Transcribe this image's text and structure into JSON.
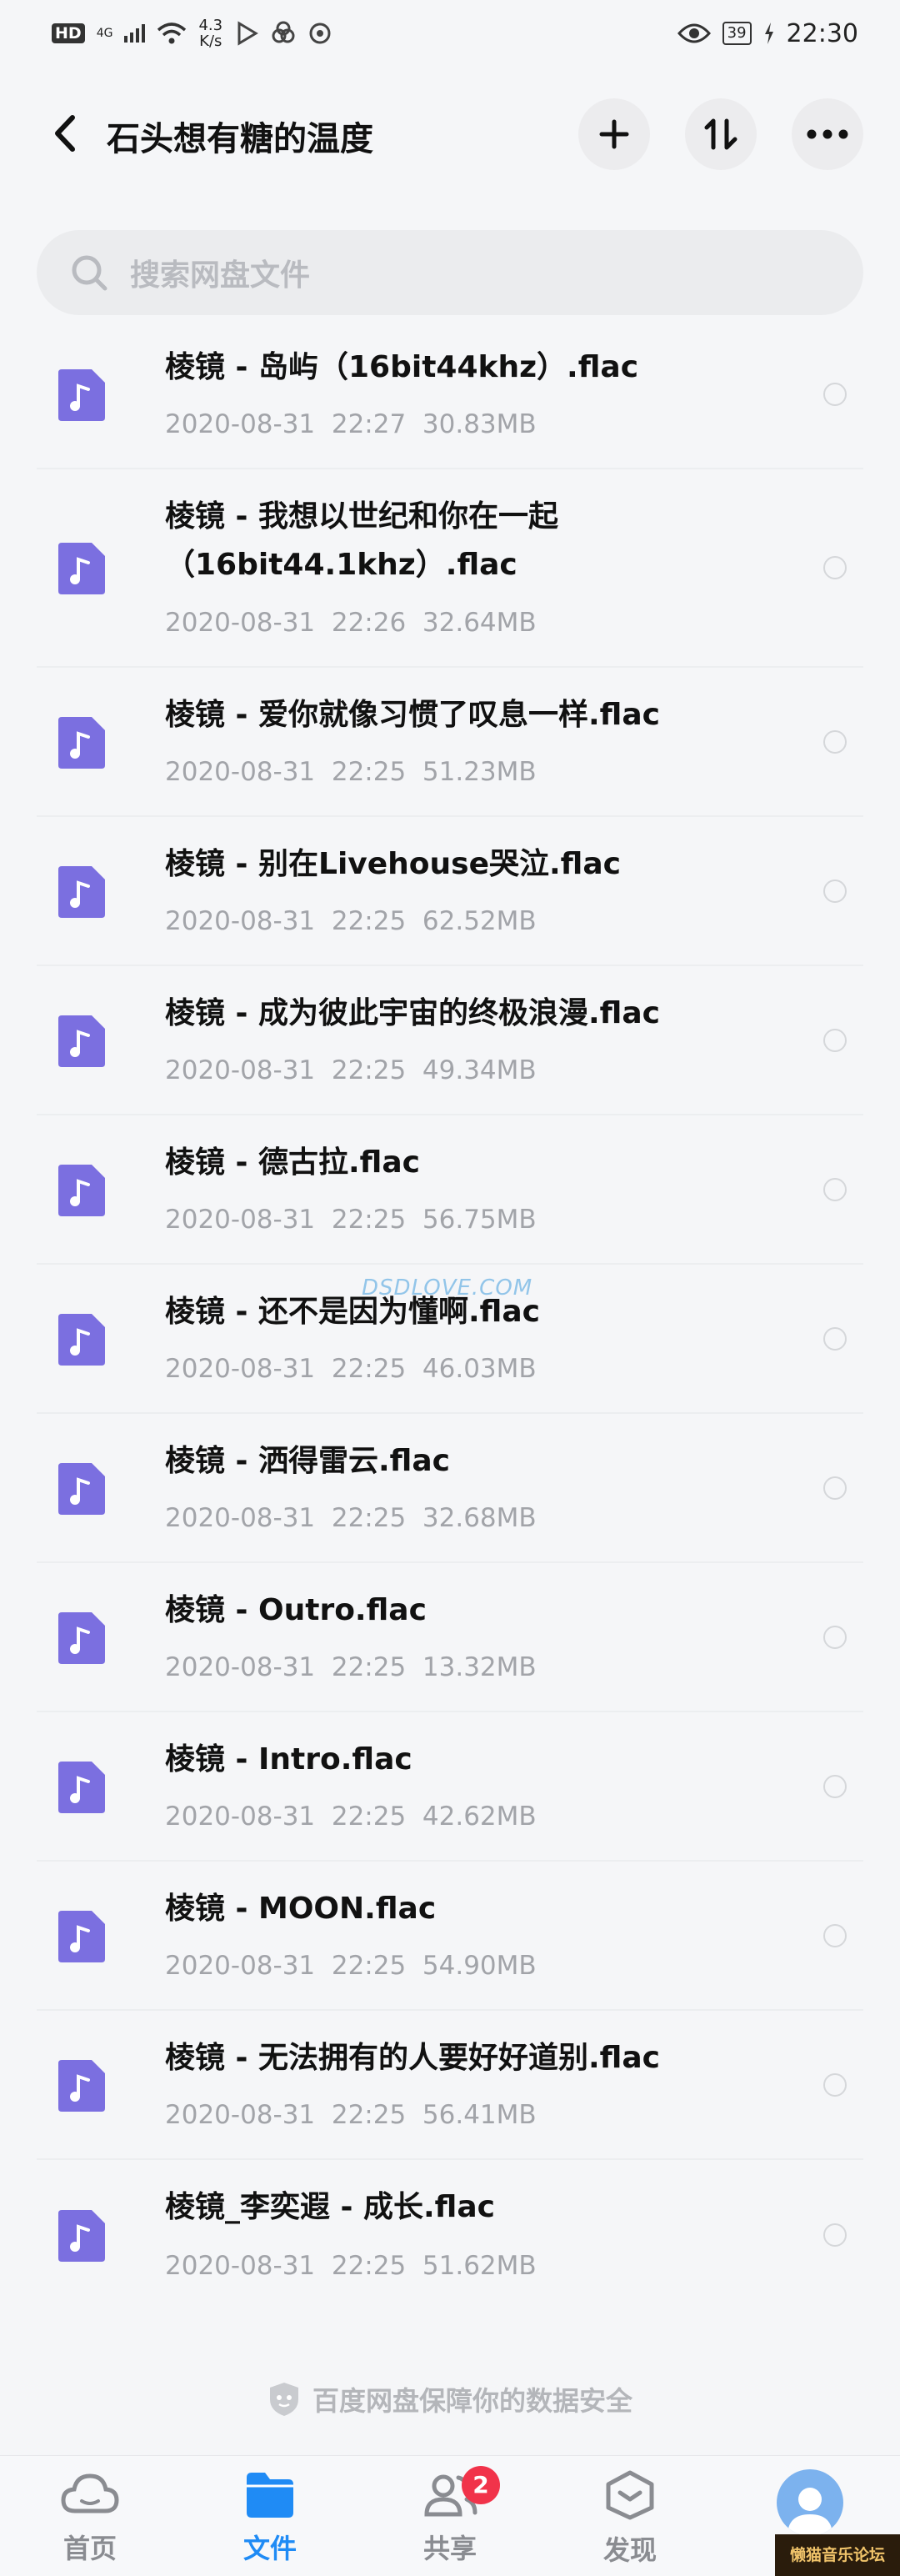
{
  "status_bar": {
    "hd": "HD",
    "network": "4G",
    "speed_value": "4.3",
    "speed_unit": "K/s",
    "battery": "39",
    "time": "22:30"
  },
  "header": {
    "title": "石头想有糖的温度"
  },
  "search": {
    "placeholder": "搜索网盘文件"
  },
  "files": [
    {
      "name": "棱镜 - 岛屿（16bit44khz）.flac",
      "meta": "2020-08-31  22:27  30.83MB"
    },
    {
      "name": "棱镜 - 我想以世纪和你在一起（16bit44.1khz）.flac",
      "meta": "2020-08-31  22:26  32.64MB"
    },
    {
      "name": "棱镜 - 爱你就像习惯了叹息一样.flac",
      "meta": "2020-08-31  22:25  51.23MB"
    },
    {
      "name": "棱镜 - 别在Livehouse哭泣.flac",
      "meta": "2020-08-31  22:25  62.52MB"
    },
    {
      "name": "棱镜 - 成为彼此宇宙的终极浪漫.flac",
      "meta": "2020-08-31  22:25  49.34MB"
    },
    {
      "name": "棱镜 - 德古拉.flac",
      "meta": "2020-08-31  22:25  56.75MB"
    },
    {
      "name": "棱镜 - 还不是因为懂啊.flac",
      "meta": "2020-08-31  22:25  46.03MB"
    },
    {
      "name": "棱镜 - 洒得雷云.flac",
      "meta": "2020-08-31  22:25  32.68MB"
    },
    {
      "name": "棱镜 - Outro.flac",
      "meta": "2020-08-31  22:25  13.32MB"
    },
    {
      "name": "棱镜 - Intro.flac",
      "meta": "2020-08-31  22:25  42.62MB"
    },
    {
      "name": "棱镜 - MOON.flac",
      "meta": "2020-08-31  22:25  54.90MB"
    },
    {
      "name": "棱镜 - 无法拥有的人要好好道别.flac",
      "meta": "2020-08-31  22:25  56.41MB"
    },
    {
      "name": "棱镜_李奕遐 - 成长.flac",
      "meta": "2020-08-31  22:25  51.62MB"
    }
  ],
  "watermark": "DSDLOVE.COM",
  "security_note": "百度网盘保障你的数据安全",
  "bottom_nav": {
    "home": "首页",
    "files": "文件",
    "share": "共享",
    "share_badge": "2",
    "discover": "发现"
  },
  "forum_stamp": "懒猫音乐论坛",
  "colors": {
    "accent": "#1f8bf5",
    "file_icon": "#7b6fe0",
    "badge": "#f1334a"
  }
}
